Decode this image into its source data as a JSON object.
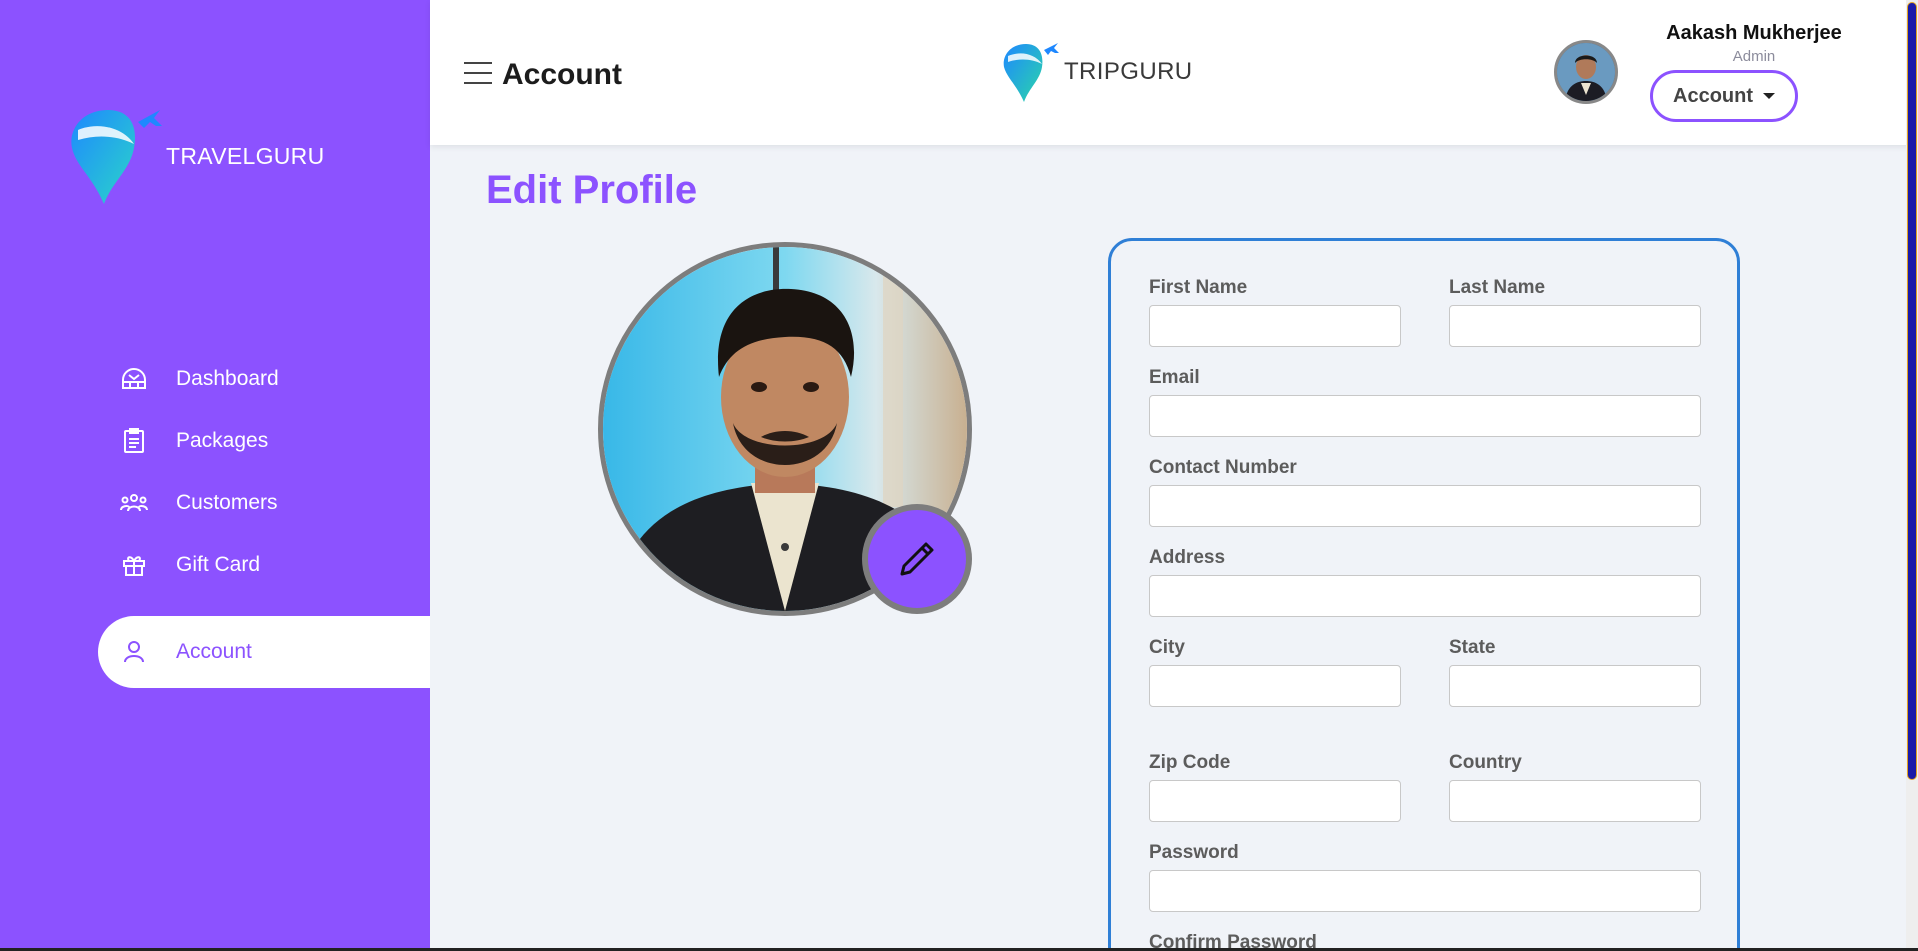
{
  "sidebar": {
    "brand": "TRAVELGURU",
    "items": [
      {
        "label": "Dashboard",
        "icon": "dashboard-icon"
      },
      {
        "label": "Packages",
        "icon": "clipboard-icon"
      },
      {
        "label": "Customers",
        "icon": "users-icon"
      },
      {
        "label": "Gift Card",
        "icon": "gift-icon"
      },
      {
        "label": "Account",
        "icon": "user-icon",
        "active": true
      }
    ]
  },
  "header": {
    "title": "Account",
    "brand": "TRIPGURU",
    "user": {
      "name": "Aakash Mukherjee",
      "role": "Admin"
    },
    "account_button": "Account"
  },
  "main": {
    "title": "Edit Profile"
  },
  "form": {
    "first_name": {
      "label": "First Name",
      "value": ""
    },
    "last_name": {
      "label": "Last Name",
      "value": ""
    },
    "email": {
      "label": "Email",
      "value": ""
    },
    "contact": {
      "label": "Contact Number",
      "value": ""
    },
    "address": {
      "label": "Address",
      "value": ""
    },
    "city": {
      "label": "City",
      "value": ""
    },
    "state": {
      "label": "State",
      "value": ""
    },
    "zip": {
      "label": "Zip Code",
      "value": ""
    },
    "country": {
      "label": "Country",
      "value": ""
    },
    "password": {
      "label": "Password",
      "value": ""
    },
    "confirm_password": {
      "label": "Confirm Password",
      "value": ""
    }
  },
  "colors": {
    "accent": "#8c52ff",
    "form_border": "#2f7fd6"
  }
}
